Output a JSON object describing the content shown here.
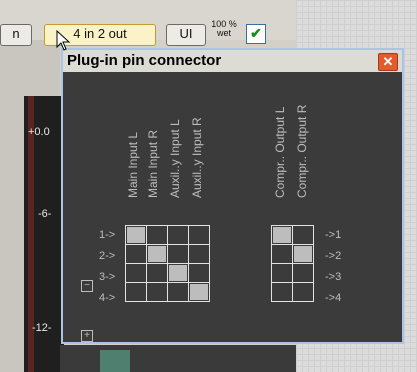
{
  "toolbar": {
    "partial_label": "n",
    "io_label": "4 in 2 out",
    "ui_label": "UI",
    "wet_percent": "100 %",
    "wet_label": "wet",
    "wet_checked_glyph": "✔"
  },
  "meter": {
    "db_labels": [
      "+0.0",
      "-6-",
      "-12-"
    ]
  },
  "dialog": {
    "title": "Plug-in pin connector",
    "close_glyph": "✕",
    "input_channels": [
      "Main Input L",
      "Main Input R",
      "Auxil..y Input L",
      "Auxil..y Input R"
    ],
    "output_channels": [
      "Compr.. Output L",
      "Compr.. Output R"
    ],
    "input_pins": [
      "1->",
      "2->",
      "3->",
      "4->"
    ],
    "output_pins": [
      "->1",
      "->2",
      "->3",
      "->4"
    ],
    "input_matrix": [
      [
        true,
        false,
        false,
        false
      ],
      [
        false,
        true,
        false,
        false
      ],
      [
        false,
        false,
        true,
        false
      ],
      [
        false,
        false,
        false,
        true
      ]
    ],
    "output_matrix": [
      [
        true,
        false
      ],
      [
        false,
        true
      ],
      [
        false,
        false
      ],
      [
        false,
        false
      ]
    ],
    "collapse_glyph": "−",
    "expand_glyph": "+"
  },
  "colors": {
    "dialog_bg": "#3b3b3b",
    "cell_on": "#bdbdbd",
    "close_button": "#e45b2e",
    "active_button": "#fbf3c8"
  }
}
